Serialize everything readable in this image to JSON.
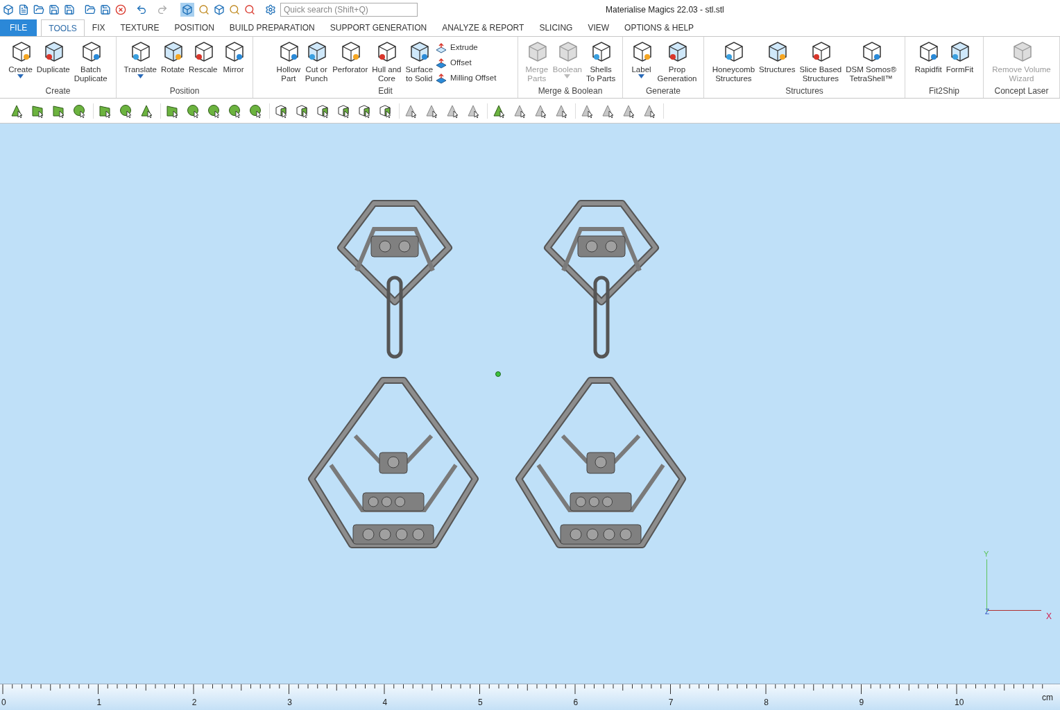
{
  "window": {
    "title": "Materialise Magics 22.03 - stl.stl"
  },
  "quick_search": {
    "placeholder": "Quick search (Shift+Q)"
  },
  "tabs": [
    {
      "label": "FILE",
      "kind": "file",
      "selected": false
    },
    {
      "label": "TOOLS",
      "kind": "tab",
      "selected": true
    },
    {
      "label": "FIX",
      "kind": "tab",
      "selected": false
    },
    {
      "label": "TEXTURE",
      "kind": "tab",
      "selected": false
    },
    {
      "label": "POSITION",
      "kind": "tab",
      "selected": false
    },
    {
      "label": "BUILD PREPARATION",
      "kind": "tab",
      "selected": false
    },
    {
      "label": "SUPPORT GENERATION",
      "kind": "tab",
      "selected": false
    },
    {
      "label": "ANALYZE & REPORT",
      "kind": "tab",
      "selected": false
    },
    {
      "label": "SLICING",
      "kind": "tab",
      "selected": false
    },
    {
      "label": "VIEW",
      "kind": "tab",
      "selected": false
    },
    {
      "label": "OPTIONS & HELP",
      "kind": "tab",
      "selected": false
    }
  ],
  "ribbon": [
    {
      "label": "Create",
      "items": [
        {
          "label": "Create",
          "kind": "large",
          "disabled": false,
          "dropdown": true
        },
        {
          "label": "Duplicate",
          "kind": "large",
          "disabled": false,
          "dropdown": false
        },
        {
          "label": "Batch\nDuplicate",
          "kind": "large",
          "disabled": false,
          "dropdown": false
        }
      ]
    },
    {
      "label": "Position",
      "items": [
        {
          "label": "Translate",
          "kind": "large",
          "disabled": false,
          "dropdown": true
        },
        {
          "label": "Rotate",
          "kind": "large",
          "disabled": false,
          "dropdown": false
        },
        {
          "label": "Rescale",
          "kind": "large",
          "disabled": false,
          "dropdown": false
        },
        {
          "label": "Mirror",
          "kind": "large",
          "disabled": false,
          "dropdown": false
        }
      ]
    },
    {
      "label": "Edit",
      "items": [
        {
          "label": "Hollow\nPart",
          "kind": "large",
          "disabled": false,
          "dropdown": false
        },
        {
          "label": "Cut or\nPunch",
          "kind": "large",
          "disabled": false,
          "dropdown": false
        },
        {
          "label": "Perforator",
          "kind": "large",
          "disabled": false,
          "dropdown": false
        },
        {
          "label": "Hull and\nCore",
          "kind": "large",
          "disabled": false,
          "dropdown": false
        },
        {
          "label": "Surface\nto Solid",
          "kind": "large",
          "disabled": false,
          "dropdown": false
        },
        {
          "label": "Extrude",
          "kind": "small",
          "disabled": false
        },
        {
          "label": "Offset",
          "kind": "small",
          "disabled": false
        },
        {
          "label": "Milling Offset",
          "kind": "small",
          "disabled": false
        }
      ]
    },
    {
      "label": "Merge & Boolean",
      "items": [
        {
          "label": "Merge\nParts",
          "kind": "large",
          "disabled": true,
          "dropdown": false
        },
        {
          "label": "Boolean",
          "kind": "large",
          "disabled": true,
          "dropdown": true
        },
        {
          "label": "Shells\nTo Parts",
          "kind": "large",
          "disabled": false,
          "dropdown": false
        }
      ]
    },
    {
      "label": "Generate",
      "items": [
        {
          "label": "Label",
          "kind": "large",
          "disabled": false,
          "dropdown": true
        },
        {
          "label": "Prop\nGeneration",
          "kind": "large",
          "disabled": false,
          "dropdown": false
        }
      ]
    },
    {
      "label": "Structures",
      "items": [
        {
          "label": "Honeycomb\nStructures",
          "kind": "large",
          "disabled": false,
          "dropdown": false
        },
        {
          "label": "Structures",
          "kind": "large",
          "disabled": false,
          "dropdown": false
        },
        {
          "label": "Slice Based\nStructures",
          "kind": "large",
          "disabled": false,
          "dropdown": false
        },
        {
          "label": "DSM Somos®\nTetraShell™",
          "kind": "large",
          "disabled": false,
          "dropdown": false
        }
      ]
    },
    {
      "label": "Fit2Ship",
      "items": [
        {
          "label": "Rapidfit",
          "kind": "large",
          "disabled": false,
          "dropdown": false
        },
        {
          "label": "FormFit",
          "kind": "large",
          "disabled": false,
          "dropdown": false
        }
      ]
    },
    {
      "label": "Concept Laser",
      "items": [
        {
          "label": "Remove Volume\nWizard",
          "kind": "large",
          "disabled": true,
          "dropdown": false
        }
      ]
    }
  ],
  "axes": {
    "y": "Y",
    "x": "X",
    "z": "Z"
  },
  "ruler": {
    "labels": [
      "0",
      "1",
      "2",
      "3",
      "4",
      "5",
      "6",
      "7",
      "8",
      "9",
      "10"
    ],
    "unit": "cm"
  }
}
